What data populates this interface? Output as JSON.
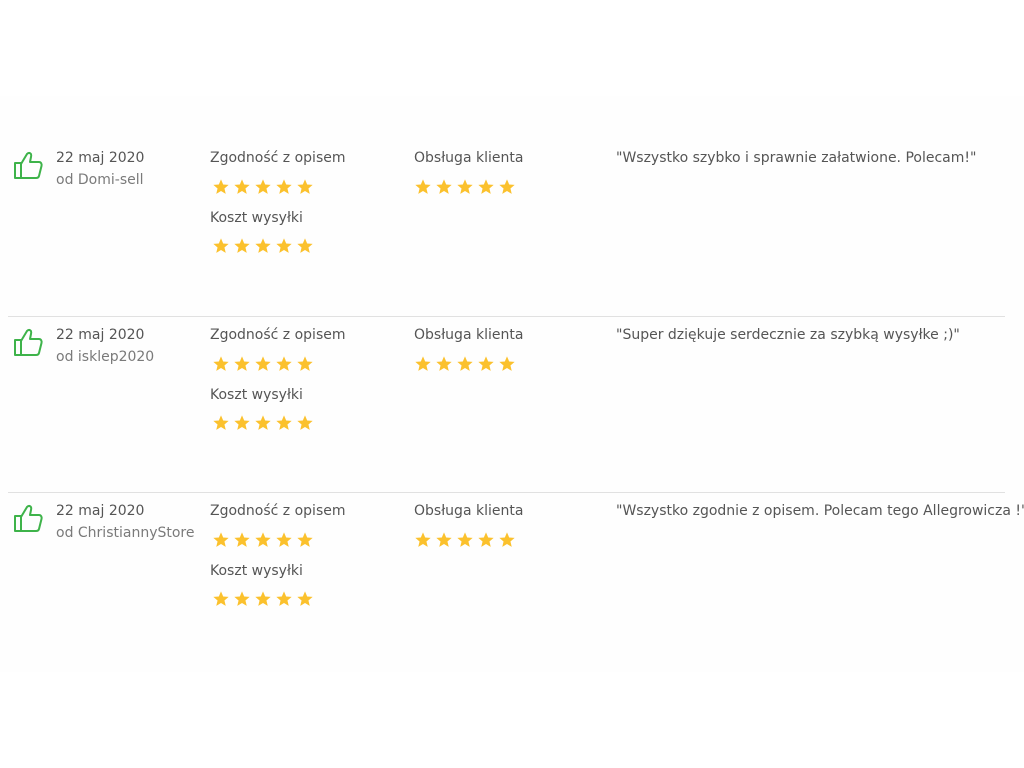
{
  "colors": {
    "star": "#fbc12d",
    "thumb_positive": "#3eb34a",
    "divider": "#e1e1e1",
    "text": "#555555",
    "muted_text": "#7a7a7a"
  },
  "icons": {
    "positive": "thumbs-up-icon",
    "rating": "star-icon"
  },
  "labels": {
    "description_accuracy": "Zgodność z opisem",
    "shipping_cost": "Koszt wysyłki",
    "customer_service": "Obsługa klienta"
  },
  "reviews": [
    {
      "date": "22 maj 2020",
      "author": "od Domi-sell",
      "comment": "\"Wszystko szybko i sprawnie załatwione. Polecam!\"",
      "ratings": {
        "description_accuracy": 5,
        "shipping_cost": 5,
        "customer_service": 5
      },
      "rating_max": 5
    },
    {
      "date": "22 maj 2020",
      "author": "od isklep2020",
      "comment": "\"Super dziękuje serdecznie za szybką wysyłke ;)\"",
      "ratings": {
        "description_accuracy": 5,
        "shipping_cost": 5,
        "customer_service": 5
      },
      "rating_max": 5
    },
    {
      "date": "22 maj 2020",
      "author": "od ChristiannyStore",
      "comment": "\"Wszystko zgodnie z opisem. Polecam tego Allegrowicza !\"",
      "ratings": {
        "description_accuracy": 5,
        "shipping_cost": 5,
        "customer_service": 5
      },
      "rating_max": 5
    }
  ]
}
